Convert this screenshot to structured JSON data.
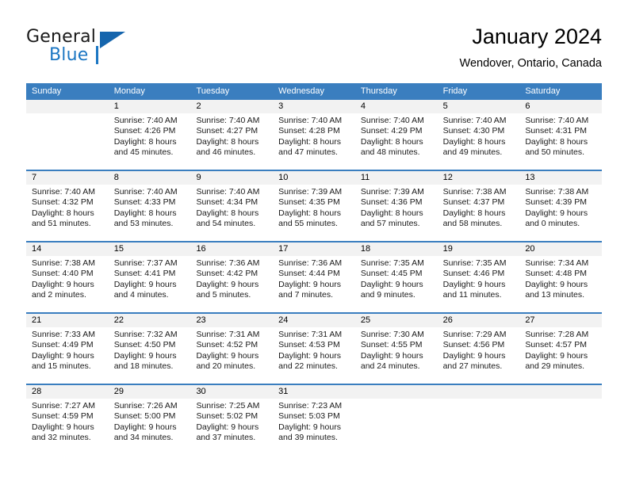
{
  "logo": {
    "word_one": "General",
    "word_two": "Blue",
    "triangle_color": "#1565ad",
    "blue_color": "#1c77c3"
  },
  "header": {
    "title": "January 2024",
    "subtitle": "Wendover, Ontario, Canada"
  },
  "theme": {
    "header_blue": "#3a7ebf",
    "day_band_gray": "#f2f2f2"
  },
  "weekdays": [
    "Sunday",
    "Monday",
    "Tuesday",
    "Wednesday",
    "Thursday",
    "Friday",
    "Saturday"
  ],
  "weeks": [
    [
      {
        "day": "",
        "sunrise": "",
        "sunset": "",
        "daylight_1": "",
        "daylight_2": ""
      },
      {
        "day": "1",
        "sunrise": "Sunrise: 7:40 AM",
        "sunset": "Sunset: 4:26 PM",
        "daylight_1": "Daylight: 8 hours",
        "daylight_2": "and 45 minutes."
      },
      {
        "day": "2",
        "sunrise": "Sunrise: 7:40 AM",
        "sunset": "Sunset: 4:27 PM",
        "daylight_1": "Daylight: 8 hours",
        "daylight_2": "and 46 minutes."
      },
      {
        "day": "3",
        "sunrise": "Sunrise: 7:40 AM",
        "sunset": "Sunset: 4:28 PM",
        "daylight_1": "Daylight: 8 hours",
        "daylight_2": "and 47 minutes."
      },
      {
        "day": "4",
        "sunrise": "Sunrise: 7:40 AM",
        "sunset": "Sunset: 4:29 PM",
        "daylight_1": "Daylight: 8 hours",
        "daylight_2": "and 48 minutes."
      },
      {
        "day": "5",
        "sunrise": "Sunrise: 7:40 AM",
        "sunset": "Sunset: 4:30 PM",
        "daylight_1": "Daylight: 8 hours",
        "daylight_2": "and 49 minutes."
      },
      {
        "day": "6",
        "sunrise": "Sunrise: 7:40 AM",
        "sunset": "Sunset: 4:31 PM",
        "daylight_1": "Daylight: 8 hours",
        "daylight_2": "and 50 minutes."
      }
    ],
    [
      {
        "day": "7",
        "sunrise": "Sunrise: 7:40 AM",
        "sunset": "Sunset: 4:32 PM",
        "daylight_1": "Daylight: 8 hours",
        "daylight_2": "and 51 minutes."
      },
      {
        "day": "8",
        "sunrise": "Sunrise: 7:40 AM",
        "sunset": "Sunset: 4:33 PM",
        "daylight_1": "Daylight: 8 hours",
        "daylight_2": "and 53 minutes."
      },
      {
        "day": "9",
        "sunrise": "Sunrise: 7:40 AM",
        "sunset": "Sunset: 4:34 PM",
        "daylight_1": "Daylight: 8 hours",
        "daylight_2": "and 54 minutes."
      },
      {
        "day": "10",
        "sunrise": "Sunrise: 7:39 AM",
        "sunset": "Sunset: 4:35 PM",
        "daylight_1": "Daylight: 8 hours",
        "daylight_2": "and 55 minutes."
      },
      {
        "day": "11",
        "sunrise": "Sunrise: 7:39 AM",
        "sunset": "Sunset: 4:36 PM",
        "daylight_1": "Daylight: 8 hours",
        "daylight_2": "and 57 minutes."
      },
      {
        "day": "12",
        "sunrise": "Sunrise: 7:38 AM",
        "sunset": "Sunset: 4:37 PM",
        "daylight_1": "Daylight: 8 hours",
        "daylight_2": "and 58 minutes."
      },
      {
        "day": "13",
        "sunrise": "Sunrise: 7:38 AM",
        "sunset": "Sunset: 4:39 PM",
        "daylight_1": "Daylight: 9 hours",
        "daylight_2": "and 0 minutes."
      }
    ],
    [
      {
        "day": "14",
        "sunrise": "Sunrise: 7:38 AM",
        "sunset": "Sunset: 4:40 PM",
        "daylight_1": "Daylight: 9 hours",
        "daylight_2": "and 2 minutes."
      },
      {
        "day": "15",
        "sunrise": "Sunrise: 7:37 AM",
        "sunset": "Sunset: 4:41 PM",
        "daylight_1": "Daylight: 9 hours",
        "daylight_2": "and 4 minutes."
      },
      {
        "day": "16",
        "sunrise": "Sunrise: 7:36 AM",
        "sunset": "Sunset: 4:42 PM",
        "daylight_1": "Daylight: 9 hours",
        "daylight_2": "and 5 minutes."
      },
      {
        "day": "17",
        "sunrise": "Sunrise: 7:36 AM",
        "sunset": "Sunset: 4:44 PM",
        "daylight_1": "Daylight: 9 hours",
        "daylight_2": "and 7 minutes."
      },
      {
        "day": "18",
        "sunrise": "Sunrise: 7:35 AM",
        "sunset": "Sunset: 4:45 PM",
        "daylight_1": "Daylight: 9 hours",
        "daylight_2": "and 9 minutes."
      },
      {
        "day": "19",
        "sunrise": "Sunrise: 7:35 AM",
        "sunset": "Sunset: 4:46 PM",
        "daylight_1": "Daylight: 9 hours",
        "daylight_2": "and 11 minutes."
      },
      {
        "day": "20",
        "sunrise": "Sunrise: 7:34 AM",
        "sunset": "Sunset: 4:48 PM",
        "daylight_1": "Daylight: 9 hours",
        "daylight_2": "and 13 minutes."
      }
    ],
    [
      {
        "day": "21",
        "sunrise": "Sunrise: 7:33 AM",
        "sunset": "Sunset: 4:49 PM",
        "daylight_1": "Daylight: 9 hours",
        "daylight_2": "and 15 minutes."
      },
      {
        "day": "22",
        "sunrise": "Sunrise: 7:32 AM",
        "sunset": "Sunset: 4:50 PM",
        "daylight_1": "Daylight: 9 hours",
        "daylight_2": "and 18 minutes."
      },
      {
        "day": "23",
        "sunrise": "Sunrise: 7:31 AM",
        "sunset": "Sunset: 4:52 PM",
        "daylight_1": "Daylight: 9 hours",
        "daylight_2": "and 20 minutes."
      },
      {
        "day": "24",
        "sunrise": "Sunrise: 7:31 AM",
        "sunset": "Sunset: 4:53 PM",
        "daylight_1": "Daylight: 9 hours",
        "daylight_2": "and 22 minutes."
      },
      {
        "day": "25",
        "sunrise": "Sunrise: 7:30 AM",
        "sunset": "Sunset: 4:55 PM",
        "daylight_1": "Daylight: 9 hours",
        "daylight_2": "and 24 minutes."
      },
      {
        "day": "26",
        "sunrise": "Sunrise: 7:29 AM",
        "sunset": "Sunset: 4:56 PM",
        "daylight_1": "Daylight: 9 hours",
        "daylight_2": "and 27 minutes."
      },
      {
        "day": "27",
        "sunrise": "Sunrise: 7:28 AM",
        "sunset": "Sunset: 4:57 PM",
        "daylight_1": "Daylight: 9 hours",
        "daylight_2": "and 29 minutes."
      }
    ],
    [
      {
        "day": "28",
        "sunrise": "Sunrise: 7:27 AM",
        "sunset": "Sunset: 4:59 PM",
        "daylight_1": "Daylight: 9 hours",
        "daylight_2": "and 32 minutes."
      },
      {
        "day": "29",
        "sunrise": "Sunrise: 7:26 AM",
        "sunset": "Sunset: 5:00 PM",
        "daylight_1": "Daylight: 9 hours",
        "daylight_2": "and 34 minutes."
      },
      {
        "day": "30",
        "sunrise": "Sunrise: 7:25 AM",
        "sunset": "Sunset: 5:02 PM",
        "daylight_1": "Daylight: 9 hours",
        "daylight_2": "and 37 minutes."
      },
      {
        "day": "31",
        "sunrise": "Sunrise: 7:23 AM",
        "sunset": "Sunset: 5:03 PM",
        "daylight_1": "Daylight: 9 hours",
        "daylight_2": "and 39 minutes."
      },
      {
        "day": "",
        "sunrise": "",
        "sunset": "",
        "daylight_1": "",
        "daylight_2": ""
      },
      {
        "day": "",
        "sunrise": "",
        "sunset": "",
        "daylight_1": "",
        "daylight_2": ""
      },
      {
        "day": "",
        "sunrise": "",
        "sunset": "",
        "daylight_1": "",
        "daylight_2": ""
      }
    ]
  ]
}
